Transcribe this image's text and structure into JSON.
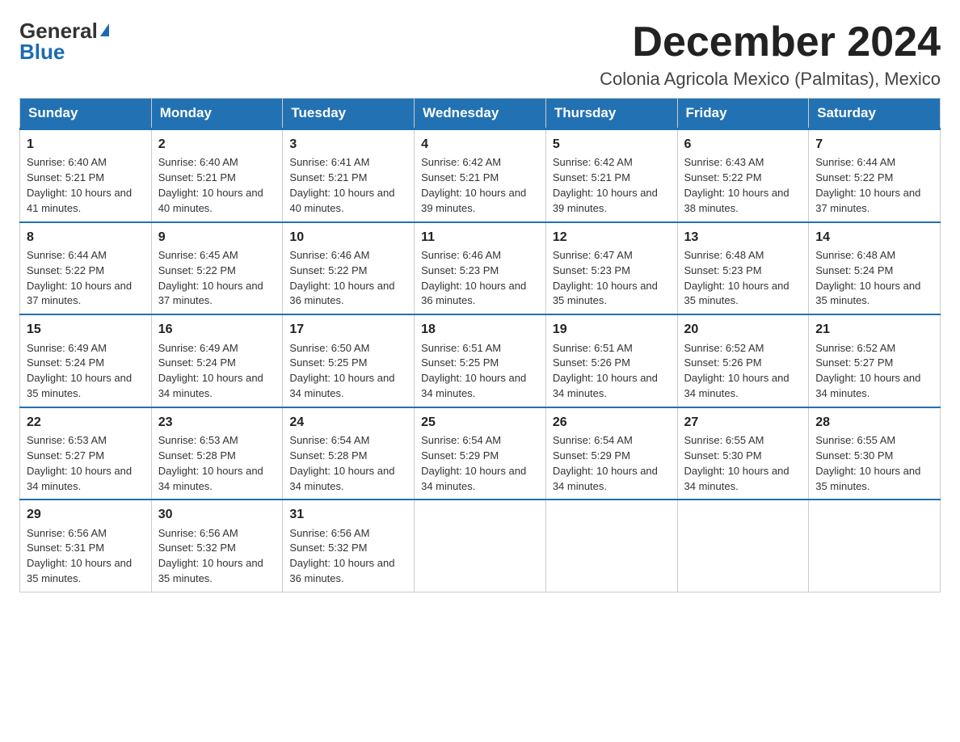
{
  "logo": {
    "text_general": "General",
    "text_blue": "Blue"
  },
  "header": {
    "month_year": "December 2024",
    "location": "Colonia Agricola Mexico (Palmitas), Mexico"
  },
  "days_of_week": [
    "Sunday",
    "Monday",
    "Tuesday",
    "Wednesday",
    "Thursday",
    "Friday",
    "Saturday"
  ],
  "weeks": [
    [
      {
        "day": "1",
        "sunrise": "Sunrise: 6:40 AM",
        "sunset": "Sunset: 5:21 PM",
        "daylight": "Daylight: 10 hours and 41 minutes."
      },
      {
        "day": "2",
        "sunrise": "Sunrise: 6:40 AM",
        "sunset": "Sunset: 5:21 PM",
        "daylight": "Daylight: 10 hours and 40 minutes."
      },
      {
        "day": "3",
        "sunrise": "Sunrise: 6:41 AM",
        "sunset": "Sunset: 5:21 PM",
        "daylight": "Daylight: 10 hours and 40 minutes."
      },
      {
        "day": "4",
        "sunrise": "Sunrise: 6:42 AM",
        "sunset": "Sunset: 5:21 PM",
        "daylight": "Daylight: 10 hours and 39 minutes."
      },
      {
        "day": "5",
        "sunrise": "Sunrise: 6:42 AM",
        "sunset": "Sunset: 5:21 PM",
        "daylight": "Daylight: 10 hours and 39 minutes."
      },
      {
        "day": "6",
        "sunrise": "Sunrise: 6:43 AM",
        "sunset": "Sunset: 5:22 PM",
        "daylight": "Daylight: 10 hours and 38 minutes."
      },
      {
        "day": "7",
        "sunrise": "Sunrise: 6:44 AM",
        "sunset": "Sunset: 5:22 PM",
        "daylight": "Daylight: 10 hours and 37 minutes."
      }
    ],
    [
      {
        "day": "8",
        "sunrise": "Sunrise: 6:44 AM",
        "sunset": "Sunset: 5:22 PM",
        "daylight": "Daylight: 10 hours and 37 minutes."
      },
      {
        "day": "9",
        "sunrise": "Sunrise: 6:45 AM",
        "sunset": "Sunset: 5:22 PM",
        "daylight": "Daylight: 10 hours and 37 minutes."
      },
      {
        "day": "10",
        "sunrise": "Sunrise: 6:46 AM",
        "sunset": "Sunset: 5:22 PM",
        "daylight": "Daylight: 10 hours and 36 minutes."
      },
      {
        "day": "11",
        "sunrise": "Sunrise: 6:46 AM",
        "sunset": "Sunset: 5:23 PM",
        "daylight": "Daylight: 10 hours and 36 minutes."
      },
      {
        "day": "12",
        "sunrise": "Sunrise: 6:47 AM",
        "sunset": "Sunset: 5:23 PM",
        "daylight": "Daylight: 10 hours and 35 minutes."
      },
      {
        "day": "13",
        "sunrise": "Sunrise: 6:48 AM",
        "sunset": "Sunset: 5:23 PM",
        "daylight": "Daylight: 10 hours and 35 minutes."
      },
      {
        "day": "14",
        "sunrise": "Sunrise: 6:48 AM",
        "sunset": "Sunset: 5:24 PM",
        "daylight": "Daylight: 10 hours and 35 minutes."
      }
    ],
    [
      {
        "day": "15",
        "sunrise": "Sunrise: 6:49 AM",
        "sunset": "Sunset: 5:24 PM",
        "daylight": "Daylight: 10 hours and 35 minutes."
      },
      {
        "day": "16",
        "sunrise": "Sunrise: 6:49 AM",
        "sunset": "Sunset: 5:24 PM",
        "daylight": "Daylight: 10 hours and 34 minutes."
      },
      {
        "day": "17",
        "sunrise": "Sunrise: 6:50 AM",
        "sunset": "Sunset: 5:25 PM",
        "daylight": "Daylight: 10 hours and 34 minutes."
      },
      {
        "day": "18",
        "sunrise": "Sunrise: 6:51 AM",
        "sunset": "Sunset: 5:25 PM",
        "daylight": "Daylight: 10 hours and 34 minutes."
      },
      {
        "day": "19",
        "sunrise": "Sunrise: 6:51 AM",
        "sunset": "Sunset: 5:26 PM",
        "daylight": "Daylight: 10 hours and 34 minutes."
      },
      {
        "day": "20",
        "sunrise": "Sunrise: 6:52 AM",
        "sunset": "Sunset: 5:26 PM",
        "daylight": "Daylight: 10 hours and 34 minutes."
      },
      {
        "day": "21",
        "sunrise": "Sunrise: 6:52 AM",
        "sunset": "Sunset: 5:27 PM",
        "daylight": "Daylight: 10 hours and 34 minutes."
      }
    ],
    [
      {
        "day": "22",
        "sunrise": "Sunrise: 6:53 AM",
        "sunset": "Sunset: 5:27 PM",
        "daylight": "Daylight: 10 hours and 34 minutes."
      },
      {
        "day": "23",
        "sunrise": "Sunrise: 6:53 AM",
        "sunset": "Sunset: 5:28 PM",
        "daylight": "Daylight: 10 hours and 34 minutes."
      },
      {
        "day": "24",
        "sunrise": "Sunrise: 6:54 AM",
        "sunset": "Sunset: 5:28 PM",
        "daylight": "Daylight: 10 hours and 34 minutes."
      },
      {
        "day": "25",
        "sunrise": "Sunrise: 6:54 AM",
        "sunset": "Sunset: 5:29 PM",
        "daylight": "Daylight: 10 hours and 34 minutes."
      },
      {
        "day": "26",
        "sunrise": "Sunrise: 6:54 AM",
        "sunset": "Sunset: 5:29 PM",
        "daylight": "Daylight: 10 hours and 34 minutes."
      },
      {
        "day": "27",
        "sunrise": "Sunrise: 6:55 AM",
        "sunset": "Sunset: 5:30 PM",
        "daylight": "Daylight: 10 hours and 34 minutes."
      },
      {
        "day": "28",
        "sunrise": "Sunrise: 6:55 AM",
        "sunset": "Sunset: 5:30 PM",
        "daylight": "Daylight: 10 hours and 35 minutes."
      }
    ],
    [
      {
        "day": "29",
        "sunrise": "Sunrise: 6:56 AM",
        "sunset": "Sunset: 5:31 PM",
        "daylight": "Daylight: 10 hours and 35 minutes."
      },
      {
        "day": "30",
        "sunrise": "Sunrise: 6:56 AM",
        "sunset": "Sunset: 5:32 PM",
        "daylight": "Daylight: 10 hours and 35 minutes."
      },
      {
        "day": "31",
        "sunrise": "Sunrise: 6:56 AM",
        "sunset": "Sunset: 5:32 PM",
        "daylight": "Daylight: 10 hours and 36 minutes."
      },
      null,
      null,
      null,
      null
    ]
  ]
}
